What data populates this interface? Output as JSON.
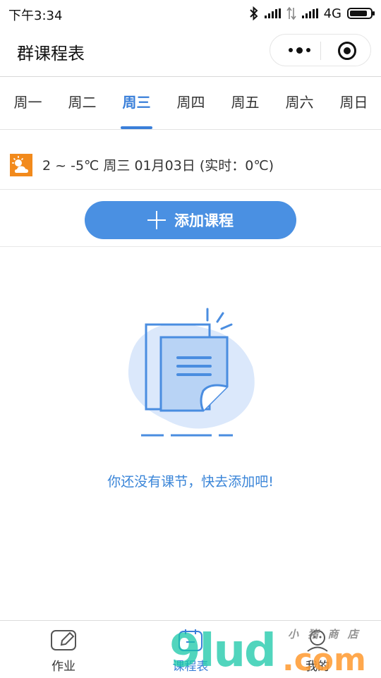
{
  "status_bar": {
    "time": "下午3:34",
    "network": "4G",
    "icons": [
      "bluetooth-icon",
      "signal-icon",
      "data-arrows-icon",
      "signal-icon",
      "battery-icon"
    ]
  },
  "header": {
    "title": "群课程表",
    "capsule_icons": [
      "more-dots-icon",
      "close-target-icon"
    ]
  },
  "weekdays": {
    "items": [
      "周一",
      "周二",
      "周三",
      "周四",
      "周五",
      "周六",
      "周日"
    ],
    "active": "周三"
  },
  "weather": {
    "icon": "sun-cloud-icon",
    "text": "2 ~ -5℃ 周三 01月03日 (实时：0℃)"
  },
  "add_course": {
    "label": "添加课程",
    "icon": "plus-icon"
  },
  "empty_state": {
    "illustration": "empty-document-illustration",
    "message": "你还没有课节，快去添加吧!"
  },
  "tab_bar": {
    "items": [
      {
        "label": "作业",
        "icon": "edit-icon"
      },
      {
        "label": "课程表",
        "icon": "calendar-icon"
      },
      {
        "label": "我的",
        "icon": "user-icon"
      }
    ],
    "active": "课程表"
  },
  "watermark": {
    "main": "9lud",
    "suffix": ".com",
    "small": "小 猪 商 店"
  },
  "colors": {
    "accent": "#3a7fd9",
    "button": "#4a90e2",
    "empty_text": "#3a85d8",
    "weather_icon": "#f28a1c"
  }
}
